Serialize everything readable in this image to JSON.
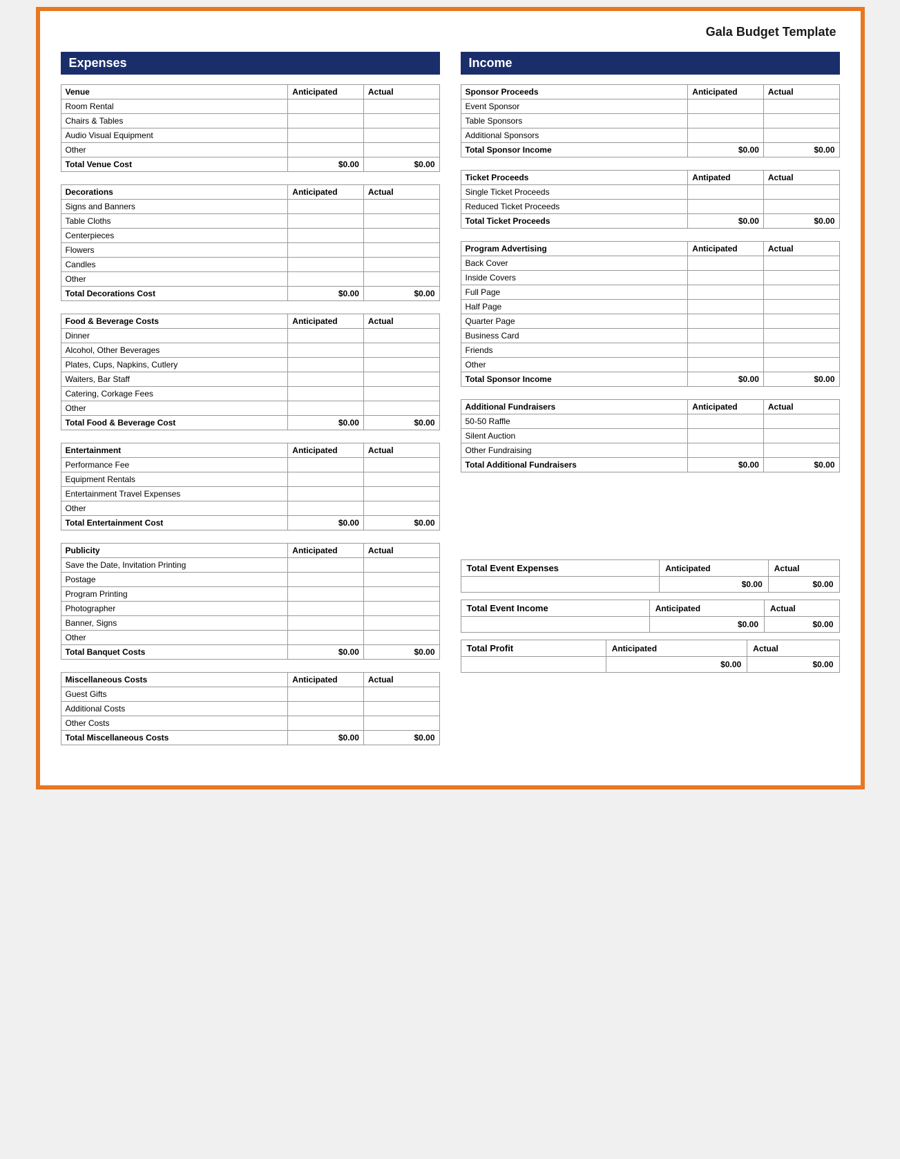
{
  "title": "Gala Budget Template",
  "expenses_header": "Expenses",
  "income_header": "Income",
  "venue": {
    "section": "Venue",
    "col_ant": "Anticipated",
    "col_act": "Actual",
    "rows": [
      "Room Rental",
      "Chairs & Tables",
      "Audio Visual Equipment",
      "Other"
    ],
    "total_label": "Total Venue Cost",
    "total_ant": "$0.00",
    "total_act": "$0.00"
  },
  "decorations": {
    "section": "Decorations",
    "col_ant": "Anticipated",
    "col_act": "Actual",
    "rows": [
      "Signs and Banners",
      "Table Cloths",
      "Centerpieces",
      "Flowers",
      "Candles",
      "Other"
    ],
    "total_label": "Total Decorations Cost",
    "total_ant": "$0.00",
    "total_act": "$0.00"
  },
  "food": {
    "section": "Food & Beverage Costs",
    "col_ant": "Anticipated",
    "col_act": "Actual",
    "rows": [
      "Dinner",
      "Alcohol, Other Beverages",
      "Plates, Cups, Napkins, Cutlery",
      "Waiters, Bar Staff",
      "Catering, Corkage Fees",
      "Other"
    ],
    "total_label": "Total Food & Beverage Cost",
    "total_ant": "$0.00",
    "total_act": "$0.00"
  },
  "entertainment": {
    "section": "Entertainment",
    "col_ant": "Anticipated",
    "col_act": "Actual",
    "rows": [
      "Performance Fee",
      "Equipment Rentals",
      "Entertainment Travel Expenses",
      "Other"
    ],
    "total_label": "Total Entertainment Cost",
    "total_ant": "$0.00",
    "total_act": "$0.00"
  },
  "publicity": {
    "section": "Publicity",
    "col_ant": "Anticipated",
    "col_act": "Actual",
    "rows": [
      "Save the Date, Invitation Printing",
      "Postage",
      "Program Printing",
      "Photographer",
      "Banner, Signs",
      "Other"
    ],
    "total_label": "Total Banquet Costs",
    "total_ant": "$0.00",
    "total_act": "$0.00"
  },
  "miscellaneous": {
    "section": "Miscellaneous Costs",
    "col_ant": "Anticipated",
    "col_act": "Actual",
    "rows": [
      "Guest Gifts",
      "Additional Costs",
      "Other Costs"
    ],
    "total_label": "Total Miscellaneous Costs",
    "total_ant": "$0.00",
    "total_act": "$0.00"
  },
  "sponsor": {
    "section": "Sponsor Proceeds",
    "col_ant": "Anticipated",
    "col_act": "Actual",
    "rows": [
      "Event Sponsor",
      "Table Sponsors",
      "Additional Sponsors"
    ],
    "total_label": "Total Sponsor Income",
    "total_ant": "$0.00",
    "total_act": "$0.00"
  },
  "ticket": {
    "section": "Ticket Proceeds",
    "col_ant": "Antipated",
    "col_act": "Actual",
    "rows": [
      "Single Ticket Proceeds",
      "Reduced Ticket Proceeds"
    ],
    "total_label": "Total Ticket Proceeds",
    "total_ant": "$0.00",
    "total_act": "$0.00"
  },
  "program_advertising": {
    "section": "Program Advertising",
    "col_ant": "Anticipated",
    "col_act": "Actual",
    "rows": [
      "Back Cover",
      "Inside Covers",
      "Full Page",
      "Half Page",
      "Quarter Page",
      "Business Card",
      "Friends",
      "Other"
    ],
    "total_label": "Total Sponsor Income",
    "total_ant": "$0.00",
    "total_act": "$0.00"
  },
  "fundraisers": {
    "section": "Additional Fundraisers",
    "col_ant": "Anticipated",
    "col_act": "Actual",
    "rows": [
      "50-50 Raffle",
      "Silent Auction",
      "Other Fundraising"
    ],
    "total_label": "Total Additional Fundraisers",
    "total_ant": "$0.00",
    "total_act": "$0.00"
  },
  "summary": {
    "expenses_label": "Total Event Expenses",
    "expenses_ant": "$0.00",
    "expenses_act": "$0.00",
    "income_label": "Total Event Income",
    "income_ant": "$0.00",
    "income_act": "$0.00",
    "profit_label": "Total Profit",
    "profit_ant": "$0.00",
    "profit_act": "$0.00",
    "col_ant": "Anticipated",
    "col_act": "Actual"
  }
}
